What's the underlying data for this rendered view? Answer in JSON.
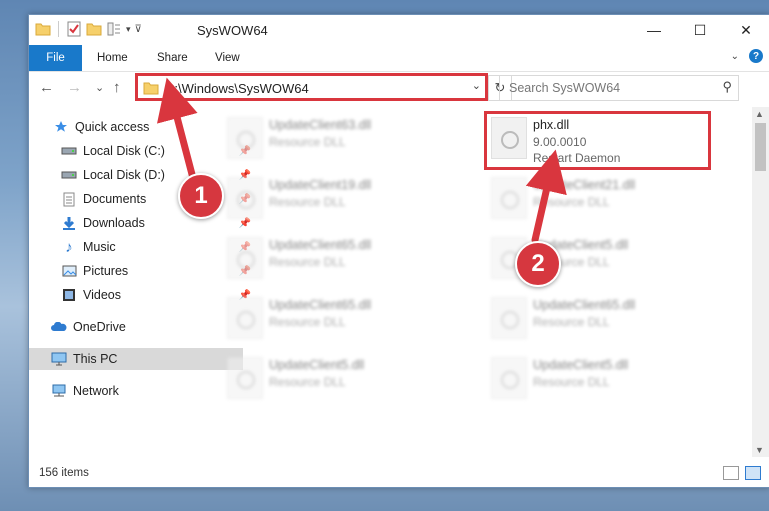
{
  "window": {
    "title": "SysWOW64",
    "controls": [
      "—",
      "☐",
      "✕"
    ]
  },
  "ribbon": {
    "tabs": [
      "File",
      "Home",
      "Share",
      "View"
    ]
  },
  "nav": {
    "back": "←",
    "forward": "→",
    "recent": "⌄",
    "up": "↑"
  },
  "address": {
    "path": "C:\\Windows\\SysWOW64"
  },
  "search": {
    "placeholder": "Search SysWOW64"
  },
  "sidebar": {
    "items": [
      {
        "label": "Quick access",
        "icon": "star-icon"
      },
      {
        "label": "Local Disk (C:)",
        "icon": "drive-icon",
        "pinned": true
      },
      {
        "label": "Local Disk (D:)",
        "icon": "drive-icon",
        "pinned": true
      },
      {
        "label": "Documents",
        "icon": "documents-icon",
        "pinned": true
      },
      {
        "label": "Downloads",
        "icon": "download-icon",
        "pinned": true
      },
      {
        "label": "Music",
        "icon": "music-icon",
        "pinned": true
      },
      {
        "label": "Pictures",
        "icon": "pictures-icon",
        "pinned": true
      },
      {
        "label": "Videos",
        "icon": "videos-icon",
        "pinned": true
      },
      {
        "label": "OneDrive",
        "icon": "cloud-icon"
      },
      {
        "label": "This PC",
        "icon": "computer-icon",
        "selected": true
      },
      {
        "label": "Network",
        "icon": "network-icon"
      }
    ]
  },
  "files": {
    "highlighted": {
      "name": "phx.dll",
      "version": "9.00.0010",
      "description": "Restart Daemon"
    },
    "left": [
      {
        "name": "UpdateClient63.dll",
        "type": "Resource DLL"
      },
      {
        "name": "UpdateClient19.dll",
        "type": "Resource DLL"
      },
      {
        "name": "UpdateClient65.dll",
        "type": "Resource DLL"
      },
      {
        "name": "UpdateClient65.dll",
        "type": "Resource DLL"
      },
      {
        "name": "UpdateClient5.dll",
        "type": "Resource DLL"
      }
    ],
    "right": [
      {
        "name": "UpdateClient21.dll",
        "type": "Resource DLL"
      },
      {
        "name": "UpdateClient5.dll",
        "type": "Resource DLL"
      },
      {
        "name": "UpdateClient65.dll",
        "type": "Resource DLL"
      },
      {
        "name": "UpdateClient5.dll",
        "type": "Resource DLL"
      }
    ]
  },
  "status": {
    "count": "156 items"
  },
  "annotations": {
    "step1": "1",
    "step2": "2",
    "color": "#d9363e"
  }
}
